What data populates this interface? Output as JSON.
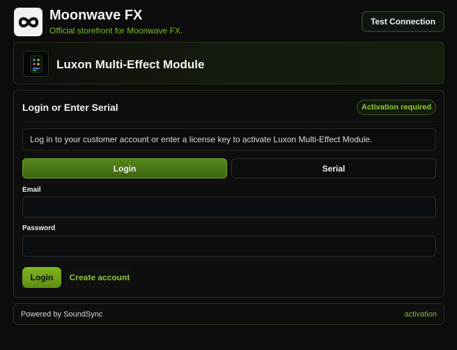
{
  "header": {
    "logo_icon": "infinity-icon",
    "title": "Moonwave FX",
    "subtitle": "Official storefront for Moonwave FX.",
    "test_connection_label": "Test Connection"
  },
  "product": {
    "thumb_icon": "plugin-thumbnail-icon",
    "title": "Luxon Multi-Effect Module"
  },
  "panel": {
    "title": "Login or Enter Serial",
    "badge": "Activation required",
    "info": "Log in to your customer account or enter a license key to activate Luxon Multi-Effect Module.",
    "tabs": [
      {
        "label": "Login",
        "active": true
      },
      {
        "label": "Serial",
        "active": false
      }
    ],
    "email_label": "Email",
    "email_value": "",
    "password_label": "Password",
    "password_value": "",
    "login_button": "Login",
    "create_account": "Create account"
  },
  "footer": {
    "powered_by": "Powered by SoundSync",
    "right_link": "activation"
  },
  "colors": {
    "accent": "#7bbf22",
    "background": "#0b0c0b",
    "tab_active": "#4c7a17"
  }
}
